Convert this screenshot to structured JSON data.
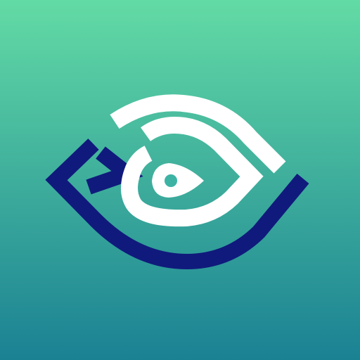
{
  "app_icon": {
    "icon_name": "stylized-eye-logo-icon",
    "colors": {
      "background_top": "#63dba5",
      "background_bottom": "#1a8193",
      "navy_stroke": "#101a7c",
      "white_stroke": "#ffffff",
      "pupil_fill": "#3db3a4"
    }
  }
}
